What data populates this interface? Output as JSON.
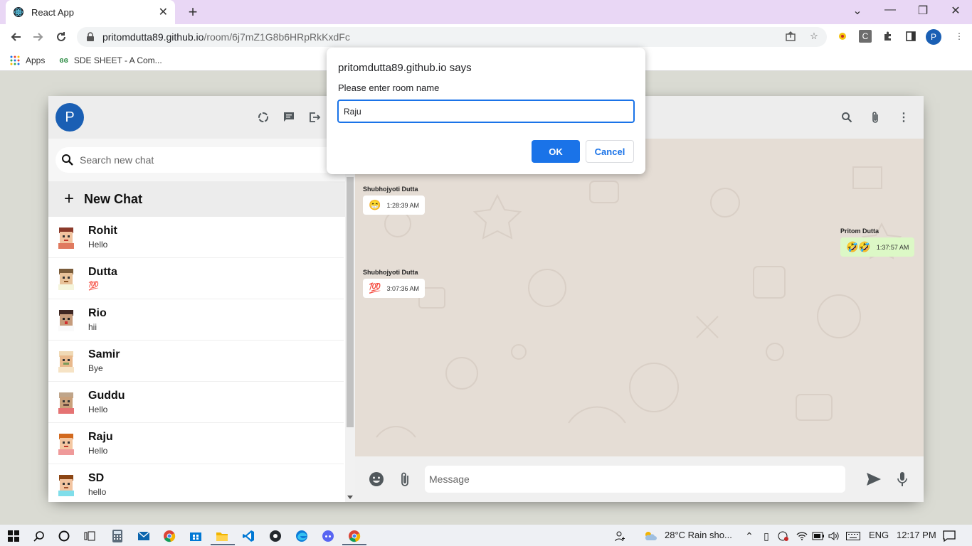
{
  "browser": {
    "tab_title": "React App",
    "url_host": "pritomdutta89.github.io",
    "url_path": "/room/6j7mZ1G8b6HRpRkKxdFc",
    "profile_initial": "P",
    "bookmarks": [
      {
        "label": "Apps",
        "icon": "apps-grid-icon"
      },
      {
        "label": "SDE SHEET - A Com...",
        "icon": "gfg-icon"
      }
    ]
  },
  "sidebar": {
    "user_initial": "P",
    "search_placeholder": "Search new chat",
    "new_chat_label": "New Chat",
    "chats": [
      {
        "name": "Rohit",
        "last": "Hello",
        "color": "#e07a5f"
      },
      {
        "name": "Dutta",
        "last": "💯",
        "color": "#c9a27a"
      },
      {
        "name": "Rio",
        "last": "hii",
        "color": "#8d6e63"
      },
      {
        "name": "Samir",
        "last": "Bye",
        "color": "#e0b07a"
      },
      {
        "name": "Guddu",
        "last": "Hello",
        "color": "#a1887f"
      },
      {
        "name": "Raju",
        "last": "Hello",
        "color": "#d2691e"
      },
      {
        "name": "SD",
        "last": "hello",
        "color": "#e6a57e"
      }
    ]
  },
  "chat": {
    "messages": [
      {
        "name": "Shubhojyoti Dutta",
        "emoji": "😁",
        "time": "1:28:39 AM"
      },
      {
        "name": "Pritom Dutta",
        "emoji": "🤣🤣",
        "time": "1:37:57 AM"
      },
      {
        "name": "Shubhojyoti Dutta",
        "emoji": "💯",
        "time": "3:07:36 AM"
      }
    ],
    "message_placeholder": "Message"
  },
  "dialog": {
    "title": "pritomdutta89.github.io says",
    "message": "Please enter room name",
    "input_value": "Raju",
    "ok_label": "OK",
    "cancel_label": "Cancel"
  },
  "taskbar": {
    "weather": "28°C  Rain sho...",
    "language": "ENG",
    "time": "12:17 PM"
  },
  "colors": {
    "accent": "#1a73e8",
    "avatar": "#1a5fb4",
    "chat_bg": "#e5ddd5",
    "sent_bubble": "#dcf8c6"
  }
}
